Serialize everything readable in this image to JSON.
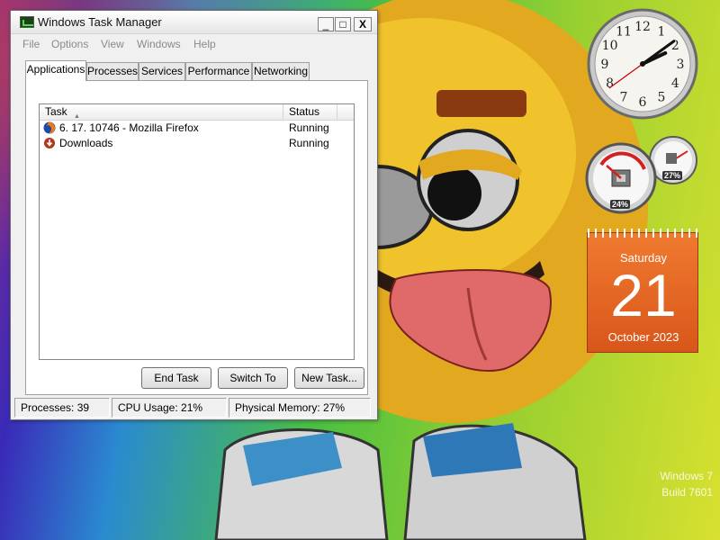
{
  "window": {
    "title": "Windows Task Manager",
    "controls": {
      "minimize": "_",
      "maximize": "□",
      "close": "X"
    }
  },
  "menu": {
    "file": "File",
    "options": "Options",
    "view": "View",
    "windows": "Windows",
    "help": "Help"
  },
  "tabs": {
    "applications": "Applications",
    "processes": "Processes",
    "services": "Services",
    "performance": "Performance",
    "networking": "Networking"
  },
  "tasks": {
    "columns": {
      "task": "Task",
      "status": "Status"
    },
    "rows": [
      {
        "task": "6. 17. 10746 - Mozilla Firefox",
        "status": "Running",
        "icon": "firefox-icon"
      },
      {
        "task": "Downloads",
        "status": "Running",
        "icon": "downloads-icon"
      }
    ]
  },
  "buttons": {
    "end_task": "End Task",
    "switch_to": "Switch To",
    "new_task": "New Task..."
  },
  "statusbar": {
    "processes": "Processes: 39",
    "cpu": "CPU Usage: 21%",
    "memory": "Physical Memory: 27%"
  },
  "gadgets": {
    "clock": {
      "hours": 2,
      "minutes": 9,
      "seconds": 39,
      "numerals": [
        "12",
        "1",
        "2",
        "3",
        "4",
        "5",
        "6",
        "7",
        "8",
        "9",
        "10",
        "11"
      ]
    },
    "cpu_meter": {
      "cpu_label": "24%",
      "cpu_value": 24,
      "memory_label": "27%",
      "memory_value": 27
    },
    "calendar": {
      "day_name": "Saturday",
      "date": "21",
      "month_year": "October 2023"
    }
  },
  "watermark": {
    "line1": "Windows 7",
    "line2": "Build 7601"
  },
  "colors": {
    "calendar_orange": "#e8661e",
    "meter_red": "#d42020",
    "titlebar_text": "#111111",
    "menu_disabled": "#8a8a8a"
  }
}
